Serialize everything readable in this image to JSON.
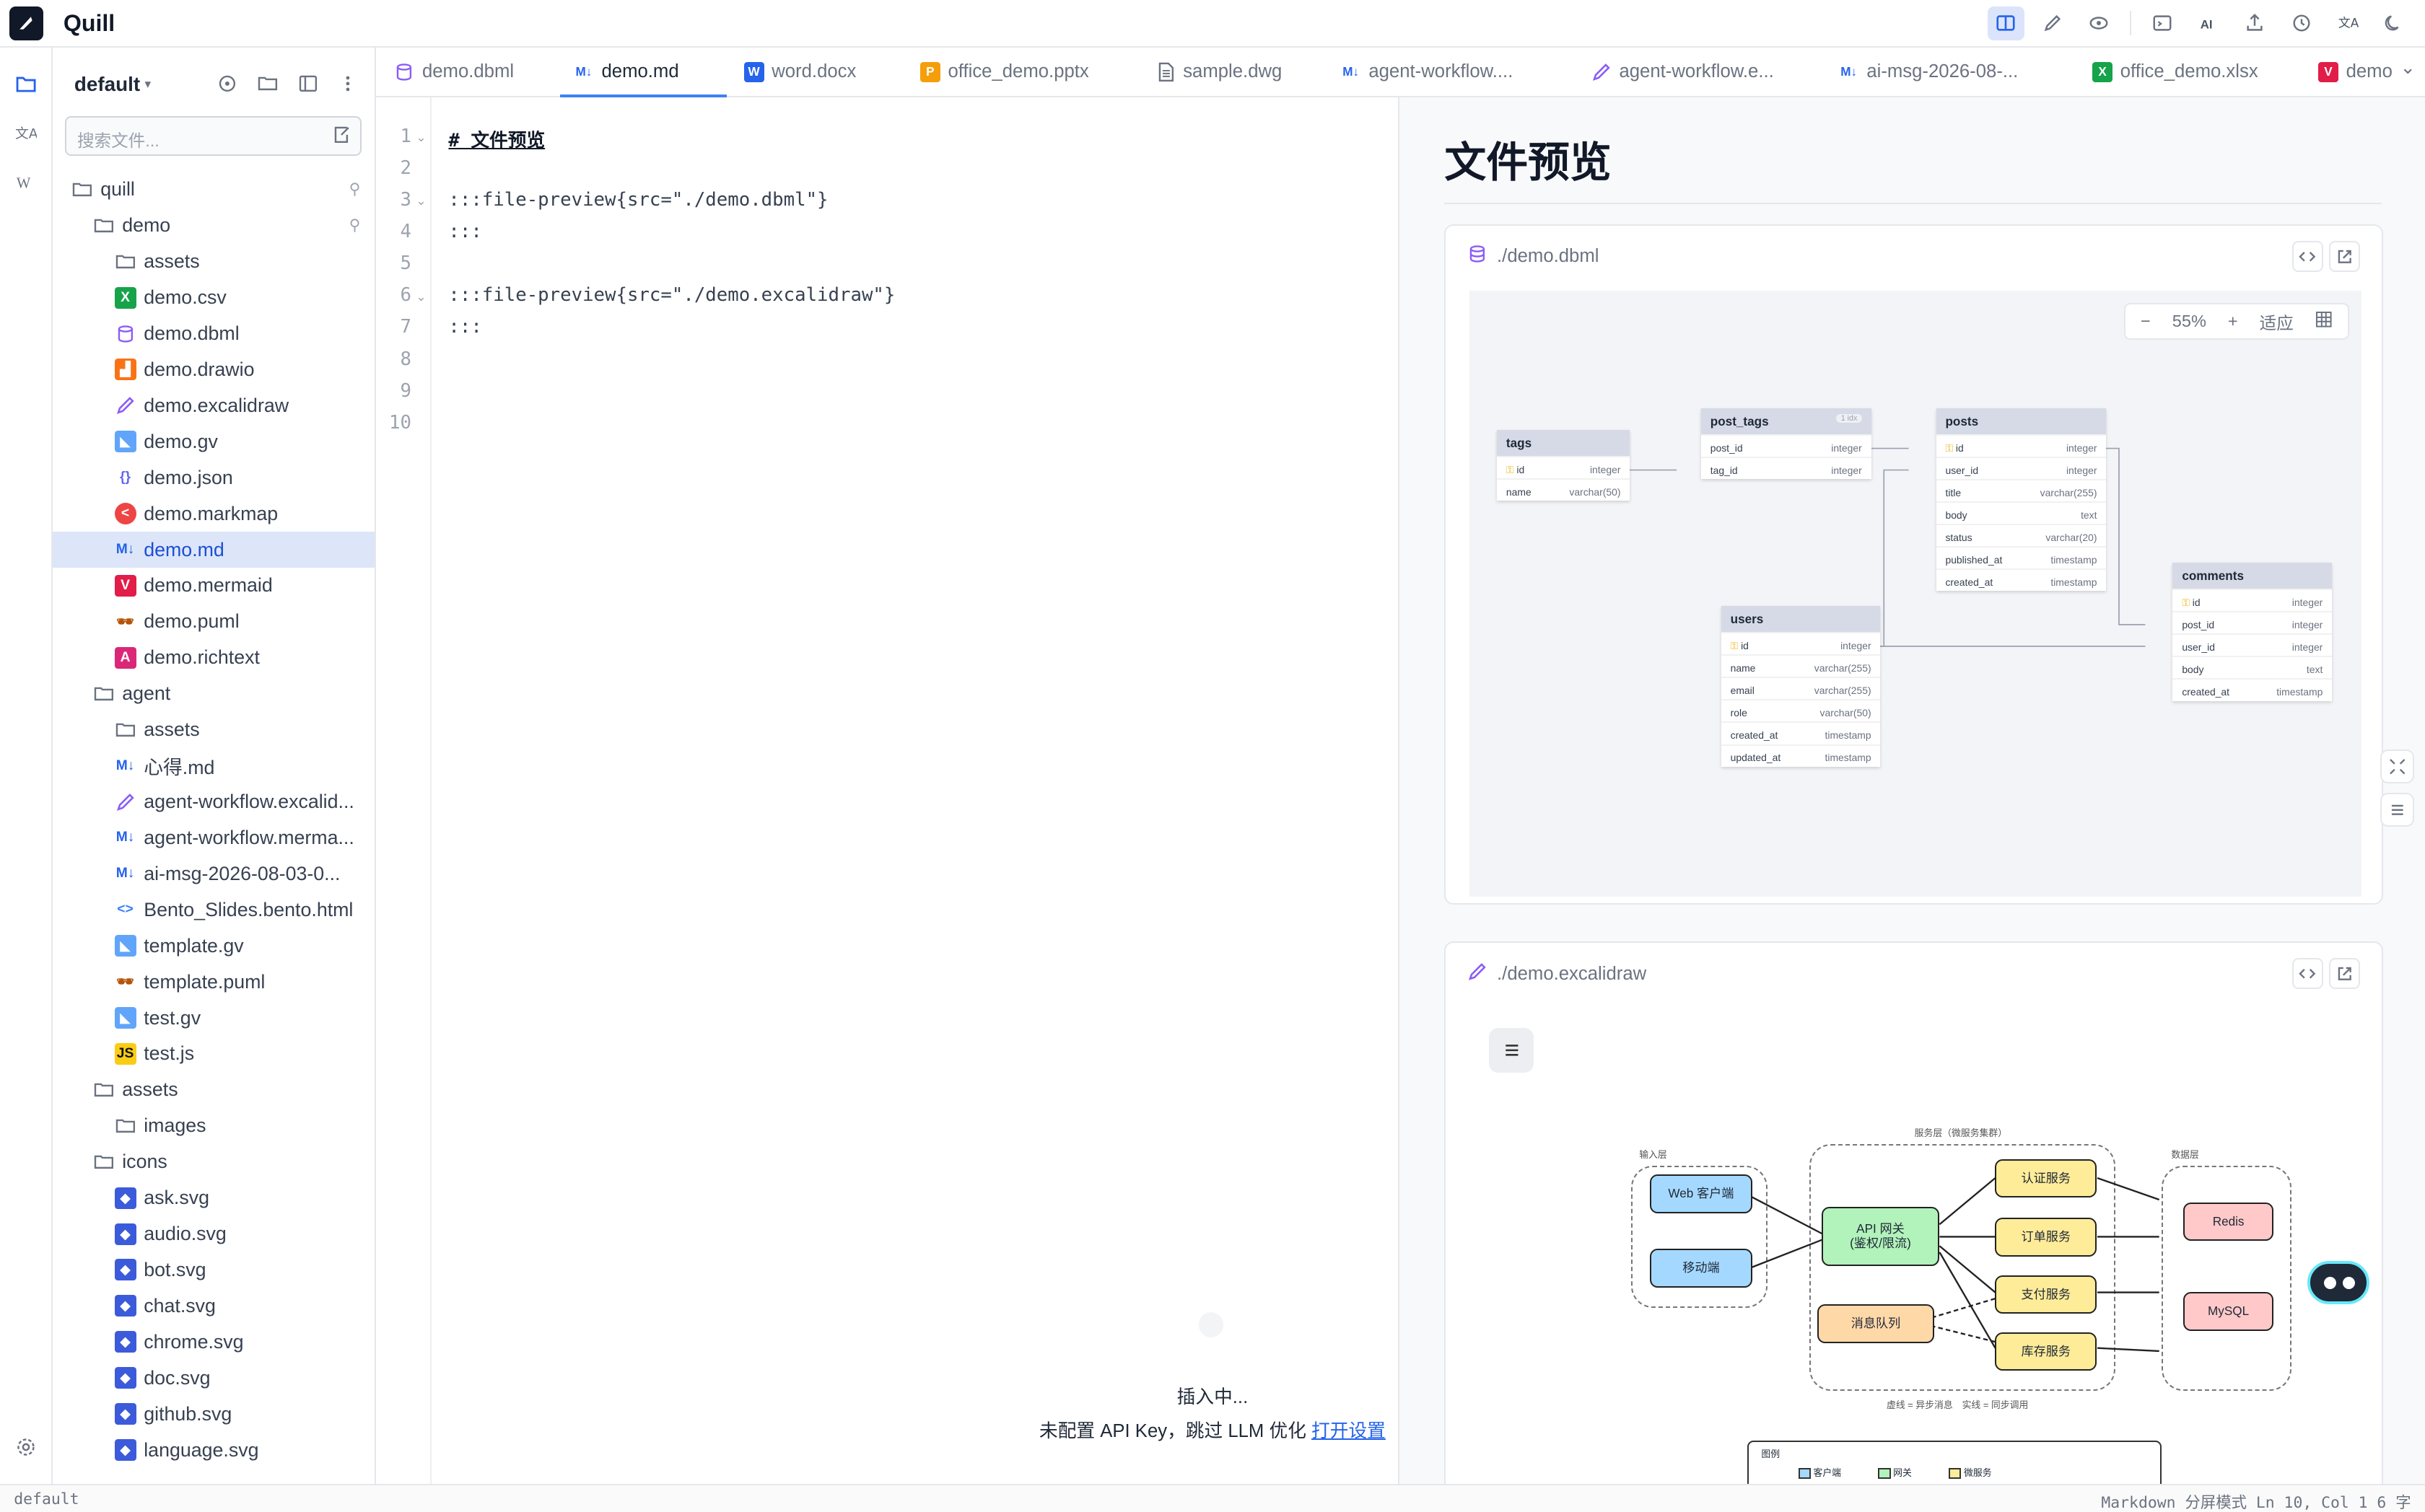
{
  "app": {
    "name": "Quill"
  },
  "sidebar": {
    "workspace": "default",
    "search_placeholder": "搜索文件...",
    "tree": [
      {
        "label": "quill",
        "type": "folder",
        "depth": 0,
        "pinned": true
      },
      {
        "label": "demo",
        "type": "folder",
        "depth": 1,
        "pinned": true
      },
      {
        "label": "assets",
        "type": "folder",
        "depth": 2
      },
      {
        "label": "demo.csv",
        "type": "csv",
        "depth": 2
      },
      {
        "label": "demo.dbml",
        "type": "dbml",
        "depth": 2
      },
      {
        "label": "demo.drawio",
        "type": "drawio",
        "depth": 2
      },
      {
        "label": "demo.excalidraw",
        "type": "excalidraw",
        "depth": 2
      },
      {
        "label": "demo.gv",
        "type": "gv",
        "depth": 2
      },
      {
        "label": "demo.json",
        "type": "json",
        "depth": 2
      },
      {
        "label": "demo.markmap",
        "type": "markmap",
        "depth": 2
      },
      {
        "label": "demo.md",
        "type": "md",
        "depth": 2,
        "selected": true
      },
      {
        "label": "demo.mermaid",
        "type": "mermaid",
        "depth": 2
      },
      {
        "label": "demo.puml",
        "type": "puml",
        "depth": 2
      },
      {
        "label": "demo.richtext",
        "type": "richtext",
        "depth": 2
      },
      {
        "label": "agent",
        "type": "folder",
        "depth": 1
      },
      {
        "label": "assets",
        "type": "folder",
        "depth": 2
      },
      {
        "label": "心得.md",
        "type": "md",
        "depth": 2
      },
      {
        "label": "agent-workflow.excalid...",
        "type": "excalidraw",
        "depth": 2
      },
      {
        "label": "agent-workflow.merma...",
        "type": "md",
        "depth": 2
      },
      {
        "label": "ai-msg-2026-08-03-0...",
        "type": "md",
        "depth": 2
      },
      {
        "label": "Bento_Slides.bento.html",
        "type": "html",
        "depth": 2
      },
      {
        "label": "template.gv",
        "type": "gv",
        "depth": 2
      },
      {
        "label": "template.puml",
        "type": "puml",
        "depth": 2
      },
      {
        "label": "test.gv",
        "type": "gv",
        "depth": 2
      },
      {
        "label": "test.js",
        "type": "js",
        "depth": 2
      },
      {
        "label": "assets",
        "type": "folder",
        "depth": 1
      },
      {
        "label": "images",
        "type": "folder",
        "depth": 2
      },
      {
        "label": "icons",
        "type": "folder",
        "depth": 1
      },
      {
        "label": "ask.svg",
        "type": "svg",
        "depth": 2
      },
      {
        "label": "audio.svg",
        "type": "svg",
        "depth": 2
      },
      {
        "label": "bot.svg",
        "type": "svg",
        "depth": 2
      },
      {
        "label": "chat.svg",
        "type": "svg",
        "depth": 2
      },
      {
        "label": "chrome.svg",
        "type": "svg",
        "depth": 2
      },
      {
        "label": "doc.svg",
        "type": "svg",
        "depth": 2
      },
      {
        "label": "github.svg",
        "type": "svg",
        "depth": 2
      },
      {
        "label": "language.svg",
        "type": "svg",
        "depth": 2
      }
    ]
  },
  "tabs": [
    {
      "label": "demo.dbml",
      "icon": "database-icon"
    },
    {
      "label": "demo.md",
      "icon": "markdown-icon",
      "active": true
    },
    {
      "label": "word.docx",
      "icon": "word-icon"
    },
    {
      "label": "office_demo.pptx",
      "icon": "powerpoint-icon"
    },
    {
      "label": "sample.dwg",
      "icon": "document-icon"
    },
    {
      "label": "agent-workflow....",
      "icon": "markdown-icon"
    },
    {
      "label": "agent-workflow.e...",
      "icon": "pencil-icon"
    },
    {
      "label": "ai-msg-2026-08-...",
      "icon": "markdown-icon"
    },
    {
      "label": "office_demo.xlsx",
      "icon": "excel-icon"
    },
    {
      "label": "demo",
      "icon": "mermaid-icon"
    }
  ],
  "editor": {
    "lines": [
      {
        "n": "1",
        "text": "# 文件预览",
        "fold": true
      },
      {
        "n": "2",
        "text": ""
      },
      {
        "n": "3",
        "text": ":::file-preview{src=\"./demo.dbml\"}",
        "fold": true
      },
      {
        "n": "4",
        "text": ":::"
      },
      {
        "n": "5",
        "text": ""
      },
      {
        "n": "6",
        "text": ":::file-preview{src=\"./demo.excalidraw\"}",
        "fold": true
      },
      {
        "n": "7",
        "text": ":::"
      },
      {
        "n": "8",
        "text": ""
      },
      {
        "n": "9",
        "text": ""
      },
      {
        "n": "10",
        "text": ""
      }
    ],
    "popup": {
      "line1": "插入中...",
      "line2": "未配置 API Key，跳过 LLM 优化",
      "link": "打开设置"
    }
  },
  "preview": {
    "title": "文件预览",
    "card1": {
      "src": "./demo.dbml",
      "zoom": "55%",
      "fit": "适应"
    },
    "card2": {
      "src": "./demo.excalidraw"
    },
    "dbml": {
      "tags": {
        "name": "tags",
        "cols": [
          [
            "id",
            "integer"
          ],
          [
            "name",
            "varchar(50)"
          ]
        ]
      },
      "post_tags": {
        "name": "post_tags",
        "badge": "1 idx",
        "cols": [
          [
            "post_id",
            "integer"
          ],
          [
            "tag_id",
            "integer"
          ]
        ]
      },
      "posts": {
        "name": "posts",
        "cols": [
          [
            "id",
            "integer"
          ],
          [
            "user_id",
            "integer"
          ],
          [
            "title",
            "varchar(255)"
          ],
          [
            "body",
            "text"
          ],
          [
            "status",
            "varchar(20)"
          ],
          [
            "published_at",
            "timestamp"
          ],
          [
            "created_at",
            "timestamp"
          ]
        ]
      },
      "users": {
        "name": "users",
        "cols": [
          [
            "id",
            "integer"
          ],
          [
            "name",
            "varchar(255)"
          ],
          [
            "email",
            "varchar(255)"
          ],
          [
            "role",
            "varchar(50)"
          ],
          [
            "created_at",
            "timestamp"
          ],
          [
            "updated_at",
            "timestamp"
          ]
        ]
      },
      "comments": {
        "name": "comments",
        "cols": [
          [
            "id",
            "integer"
          ],
          [
            "post_id",
            "integer"
          ],
          [
            "user_id",
            "integer"
          ],
          [
            "body",
            "text"
          ],
          [
            "created_at",
            "timestamp"
          ]
        ]
      }
    },
    "excalidraw": {
      "input_layer": "输入层",
      "service_layer": "服务层（微服务集群）",
      "data_layer": "数据层",
      "web": "Web 客户端",
      "mobile": "移动端",
      "gateway": "API 网关\n(鉴权/限流)",
      "mq": "消息队列",
      "auth": "认证服务",
      "order": "订单服务",
      "pay": "支付服务",
      "stock": "库存服务",
      "redis": "Redis",
      "mysql": "MySQL",
      "caption": "虚线 = 异步消息　实线 = 同步调用",
      "legend": {
        "title": "图例",
        "client": "客户端",
        "gateway": "网关",
        "micro": "微服务"
      }
    }
  },
  "statusbar": {
    "left": "default",
    "right": "Markdown  分屏模式  Ln 10, Col 1  6 字"
  }
}
